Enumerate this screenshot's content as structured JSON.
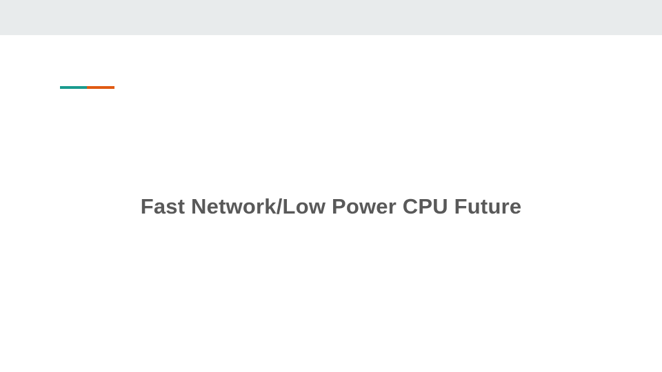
{
  "slide": {
    "title": "Fast Network/Low Power CPU Future"
  },
  "colors": {
    "top_band": "#e8ebec",
    "background": "#ffffff",
    "accent_teal": "#1a9b8e",
    "accent_orange": "#e05a12",
    "title_text": "#595959"
  }
}
